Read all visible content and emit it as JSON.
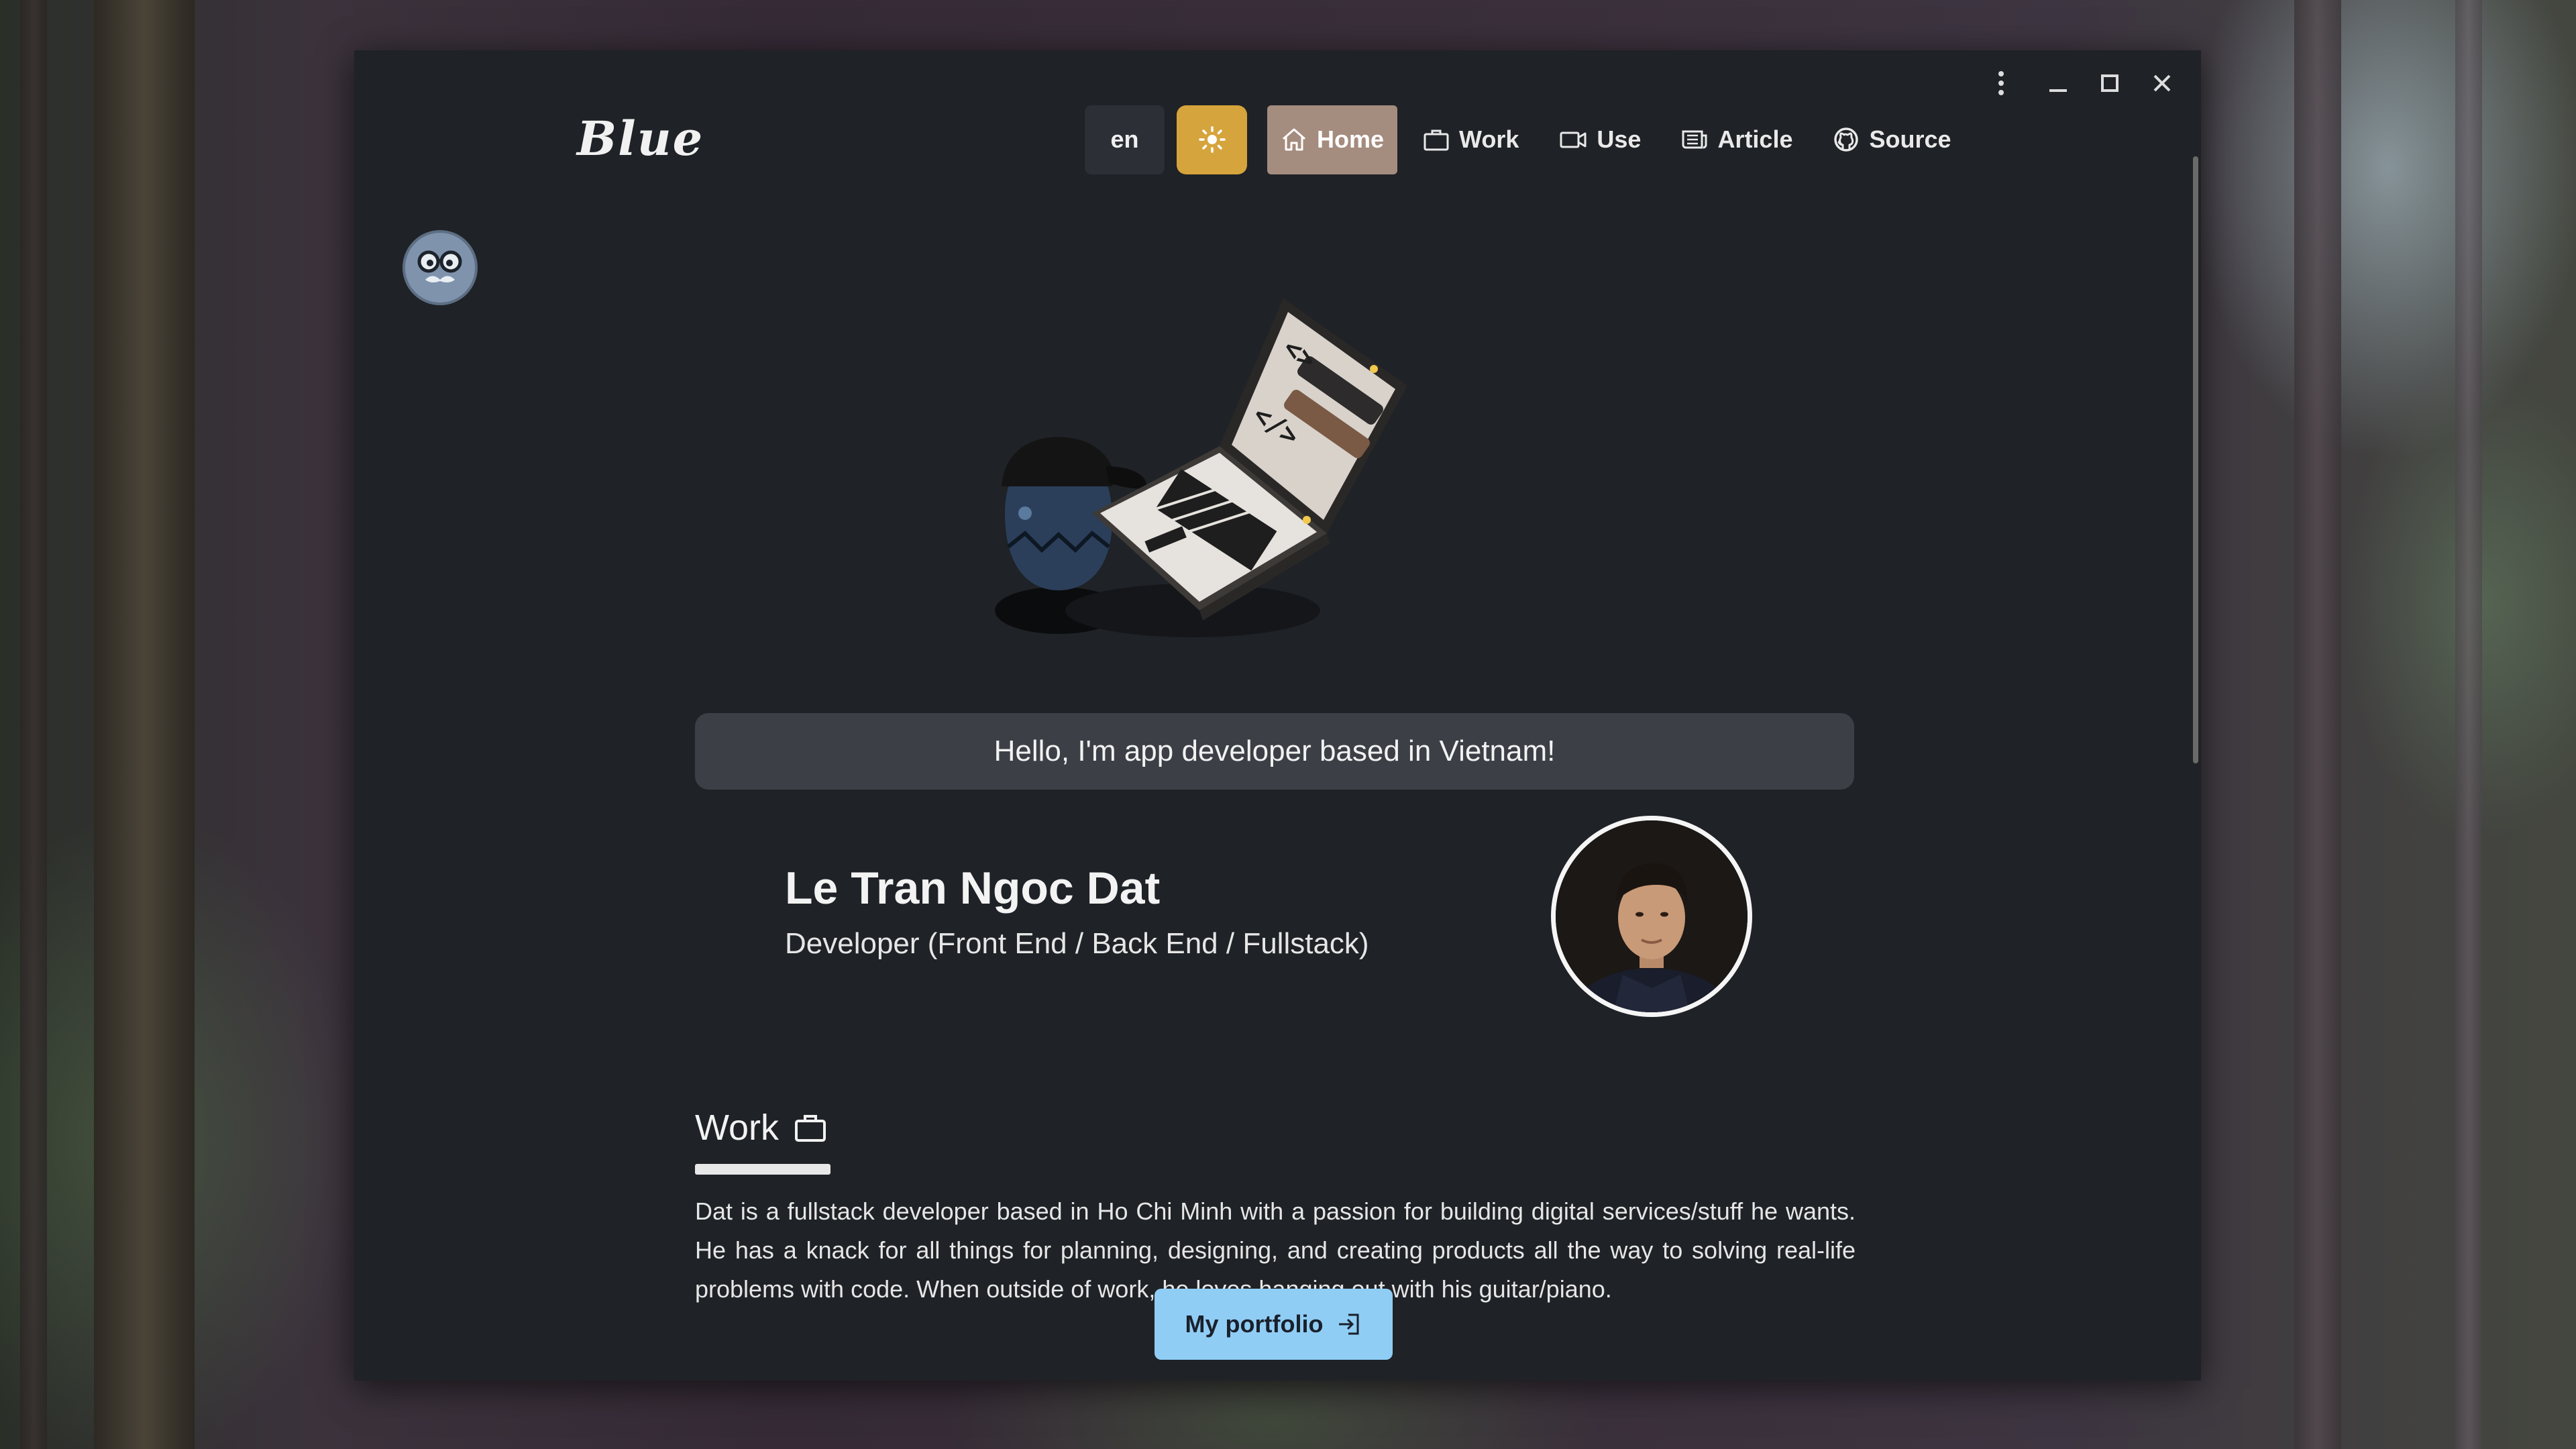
{
  "window": {
    "controls": [
      "more-options",
      "minimize",
      "maximize",
      "close"
    ]
  },
  "header": {
    "logo": "Blue",
    "language": "en",
    "theme_icon": "sun-icon",
    "nav": [
      {
        "label": "Home",
        "icon": "home-icon",
        "active": true
      },
      {
        "label": "Work",
        "icon": "briefcase-icon",
        "active": false
      },
      {
        "label": "Use",
        "icon": "video-camera-icon",
        "active": false
      },
      {
        "label": "Article",
        "icon": "newspaper-icon",
        "active": false
      },
      {
        "label": "Source",
        "icon": "github-icon",
        "active": false
      }
    ]
  },
  "main": {
    "greeting": "Hello, I'm app developer based in Vietnam!",
    "profile": {
      "name": "Le Tran Ngoc Dat",
      "role": "Developer (Front End / Back End / Fullstack)"
    },
    "work_section": {
      "title": "Work",
      "icon": "briefcase-icon",
      "bio": "Dat is a fullstack developer based in Ho Chi Minh with a passion for building digital services/stuff he wants. He has a knack for all things for planning, designing, and creating products all the way to solving real-life problems with code. When outside of work, he loves hanging out with his guitar/piano.",
      "cta_label": "My portfolio",
      "cta_icon": "login-arrow-icon"
    }
  },
  "colors": {
    "window_bg": "#1f2226",
    "theme_button": "#d6a43c",
    "active_nav": "#a48c7e",
    "greeting_bg": "#3c4046",
    "cta_bg": "#90cdf4"
  }
}
